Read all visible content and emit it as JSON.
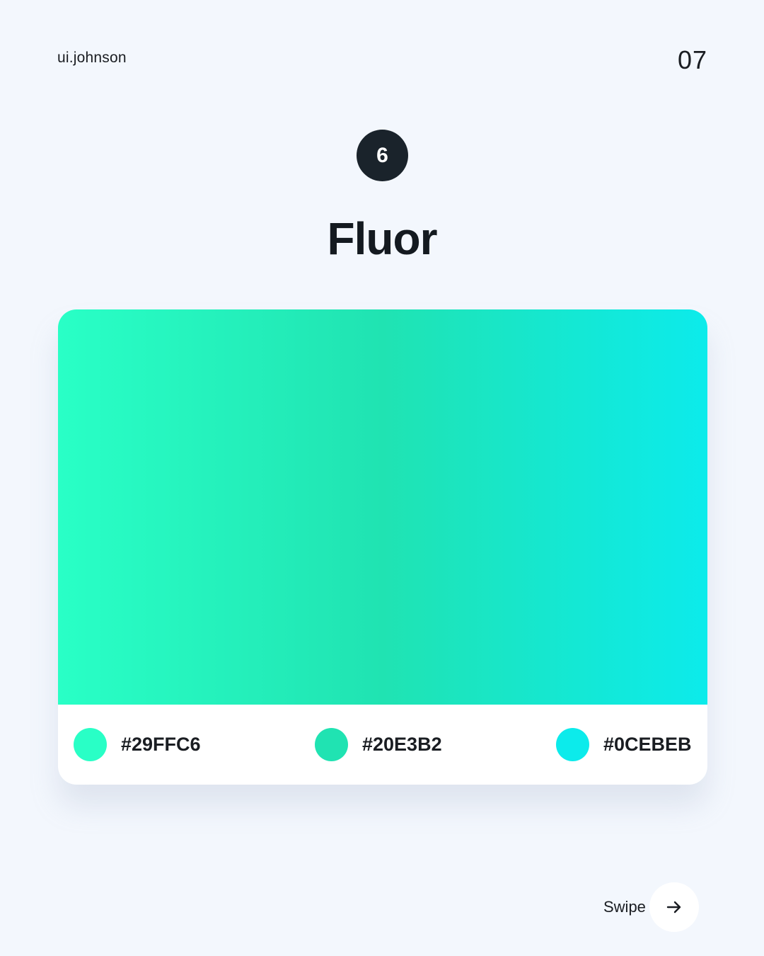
{
  "header": {
    "brand": "ui.johnson",
    "page_number": "07"
  },
  "step": {
    "number": "6"
  },
  "palette": {
    "name": "Fluor",
    "swatches": [
      {
        "hex": "#29FFC6",
        "color": "#29ffc6"
      },
      {
        "hex": "#20E3B2",
        "color": "#20e3b2"
      },
      {
        "hex": "#0CEBEB",
        "color": "#0cebeb"
      }
    ]
  },
  "footer": {
    "swipe_label": "Swipe",
    "swipe_icon": "arrow-right-icon"
  }
}
